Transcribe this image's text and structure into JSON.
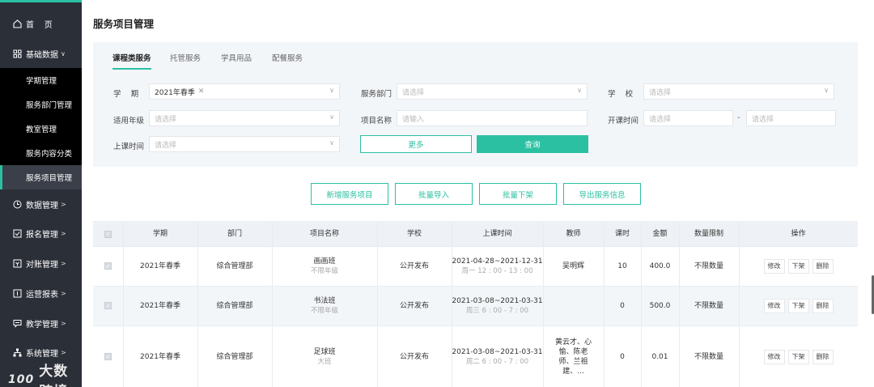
{
  "sidebar": {
    "home": "首    页",
    "basic": "基础数据",
    "sub_items": [
      "学期管理",
      "服务部门管理",
      "教室管理",
      "服务内容分类",
      "服务项目管理"
    ],
    "groups": [
      "数据管理",
      "报名管理",
      "对账管理",
      "运营报表",
      "教学管理",
      "系统管理"
    ]
  },
  "watermark": {
    "logo": "100",
    "text": "大数跨境"
  },
  "page_title": "服务项目管理",
  "tabs": [
    "课程类服务",
    "托管服务",
    "学具用品",
    "配餐服务"
  ],
  "filters": {
    "term_label": "学    期",
    "term_value": "2021年春季",
    "dept_label": "服务部门",
    "dept_placeholder": "请选择",
    "school_label": "学    校",
    "school_placeholder": "请选择",
    "grade_label": "适用年级",
    "grade_placeholder": "请选择",
    "name_label": "项目名称",
    "name_placeholder": "请输入",
    "start_label": "开课时间",
    "start_from": "请选择",
    "start_to": "请选择",
    "dash": "-",
    "class_label": "上课时间",
    "class_placeholder": "请选择",
    "more": "更多",
    "query": "查询"
  },
  "actions": [
    "新增服务项目",
    "批量导入",
    "批量下架",
    "导出服务信息"
  ],
  "table": {
    "headers": [
      "学期",
      "部门",
      "项目名称",
      "学校",
      "上课时间",
      "教师",
      "课时",
      "金额",
      "数量限制",
      "操作"
    ],
    "ops": [
      "修改",
      "下架",
      "删除"
    ],
    "rows": [
      {
        "term": "2021年春季",
        "dept": "综合管理部",
        "name": "画画班",
        "grade": "不限年级",
        "school": "公开发布",
        "date": "2021-04-28~2021-12-31",
        "time": "周一 12 : 00 - 13 : 00",
        "teacher": "吴明辉",
        "hours": "10",
        "amount": "400.0",
        "limit": "不限数量"
      },
      {
        "term": "2021年春季",
        "dept": "综合管理部",
        "name": "书法班",
        "grade": "不限年级",
        "school": "公开发布",
        "date": "2021-03-08~2021-03-31",
        "time": "周三 6 : 00 - 7 : 00",
        "teacher": "",
        "hours": "0",
        "amount": "500.0",
        "limit": "不限数量"
      },
      {
        "term": "2021年春季",
        "dept": "综合管理部",
        "name": "足球班",
        "grade": "大班",
        "school": "公开发布",
        "date": "2021-03-08~2021-03-31",
        "time": "周二 6 : 00 - 7 : 00",
        "teacher_lines": [
          "黄云才、心",
          "愉、陈老",
          "师、兰祖",
          "建、..."
        ],
        "hours": "0",
        "amount": "0.01",
        "limit": "不限数量"
      }
    ]
  }
}
